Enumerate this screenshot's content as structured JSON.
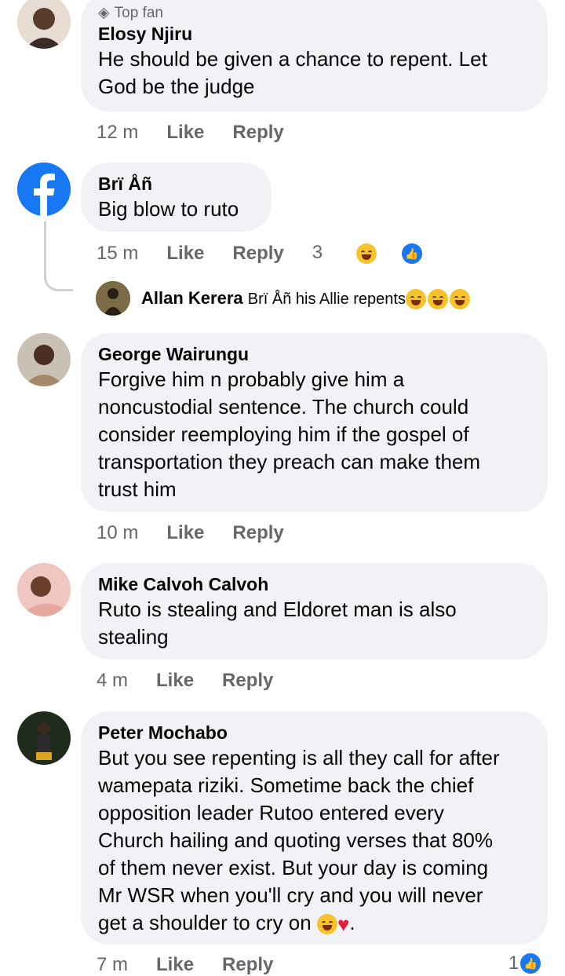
{
  "colors": {
    "bubble": "#f0f2f5",
    "meta": "#65676b",
    "facebook_blue": "#1877f2"
  },
  "comments": [
    {
      "badge": "Top fan",
      "badge_icon": "diamond-icon",
      "author": "Elosy Njiru",
      "text_lines": [
        "He should be given a chance to repent. Let",
        "God be the judge"
      ],
      "time": "12 m",
      "like": "Like",
      "reply": "Reply"
    },
    {
      "author": "Brï Åñ",
      "avatar_icon": "facebook-logo-icon",
      "text_lines": [
        "Big blow to ruto"
      ],
      "time": "15 m",
      "like": "Like",
      "reply": "Reply",
      "reactions_count": "3",
      "reactions": [
        "haha-emoji",
        "like-reaction"
      ]
    },
    {
      "author": "George Wairungu",
      "text_lines": [
        "Forgive him n probably give him a",
        "noncustodial sentence. The church could",
        "consider reemploying him if the gospel of",
        "transportation they preach can make them",
        "trust him"
      ],
      "time": "10 m",
      "like": "Like",
      "reply": "Reply"
    },
    {
      "author": "Mike Calvoh Calvoh",
      "text_lines": [
        "Ruto is stealing and Eldoret man is also",
        "stealing"
      ],
      "time": "4 m",
      "like": "Like",
      "reply": "Reply"
    },
    {
      "author": "Peter Mochabo",
      "text_lines": [
        "But you see repenting is all they call for after",
        "wamepata riziki. Sometime back the chief",
        "opposition leader Rutoo entered every",
        "Church hailing and quoting verses that 80%",
        "of them never exist. But your day is coming",
        "Mr WSR when you'll cry and you will never"
      ],
      "last_line": "get a shoulder to cry on",
      "last_line_end": ".",
      "time": "7 m",
      "like": "Like",
      "reply": "Reply",
      "reactions_count": "1"
    }
  ],
  "reply_preview": {
    "author": "Allan Kerera",
    "text": "Brï Åñ his Allie repents"
  }
}
